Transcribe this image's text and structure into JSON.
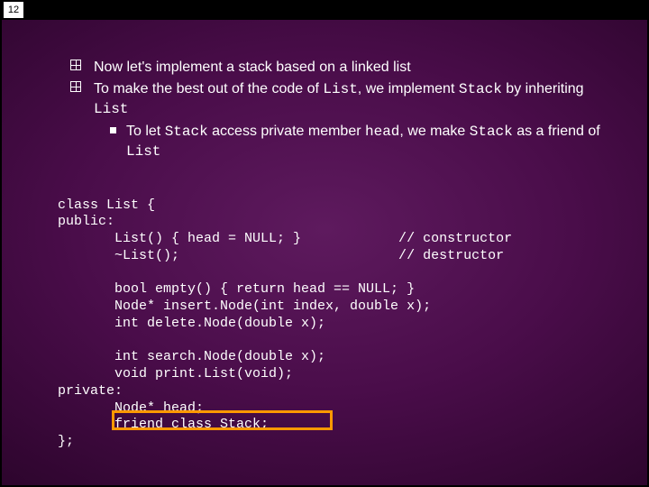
{
  "page_number": "12",
  "bullets": {
    "b1": "Now let's implement a stack based on a linked list",
    "b2_pre": "To make the best out of the code of ",
    "b2_list": "List",
    "b2_mid": ", we implement ",
    "b2_stack": "Stack",
    "b2_post": " by inheriting ",
    "b2_list2": "List",
    "b3_pre": "To let ",
    "b3_stack": "Stack",
    "b3_mid": " access private member ",
    "b3_head": "head",
    "b3_mid2": ", we make ",
    "b3_stack2": "Stack",
    "b3_mid3": " as a friend of ",
    "b3_list": "List"
  },
  "code": {
    "l1": "class List {",
    "l2": "public:",
    "l3": "       List() { head = NULL; }            // constructor",
    "l4": "       ~List();                           // destructor",
    "l5": "",
    "l6": "       bool empty() { return head == NULL; }",
    "l7": "       Node* insert.Node(int index, double x);",
    "l8": "       int delete.Node(double x);",
    "l9": "",
    "l10": "       int search.Node(double x);",
    "l11": "       void print.List(void);",
    "l12": "private:",
    "l13": "       Node* head;",
    "l14": "       friend class Stack;",
    "l15": "};"
  }
}
